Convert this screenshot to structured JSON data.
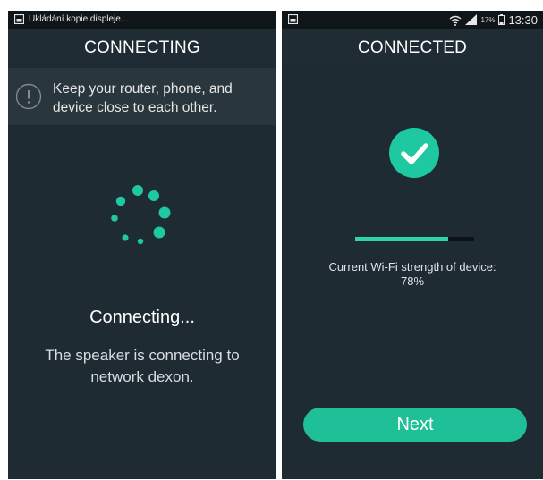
{
  "left_screen": {
    "status_bar": {
      "notification_text": "Ukládání kopie displeje...",
      "icon": "screenshot-icon"
    },
    "title": "CONNECTING",
    "tip": {
      "icon": "info-exclamation-icon",
      "text": "Keep your router, phone, and device close to each other."
    },
    "spinner_icon": "loading-spinner-icon",
    "status_title": "Connecting...",
    "status_description": "The speaker is connecting to network dexon."
  },
  "right_screen": {
    "status_bar": {
      "icon": "screenshot-icon",
      "battery_percent": "17%",
      "time": "13:30",
      "wifi_icon": "wifi-icon",
      "signal_icon": "signal-icon",
      "battery_icon": "battery-icon"
    },
    "title": "CONNECTED",
    "success_icon": "checkmark-icon",
    "wifi_strength": {
      "label": "Current Wi-Fi strength of device:",
      "value_text": "78%",
      "value_fraction": 0.78
    },
    "next_button_label": "Next"
  },
  "colors": {
    "accent": "#1ec8a0",
    "background": "#1e2b33",
    "tip_background": "#2a363d",
    "status_bar": "#0f1519"
  }
}
